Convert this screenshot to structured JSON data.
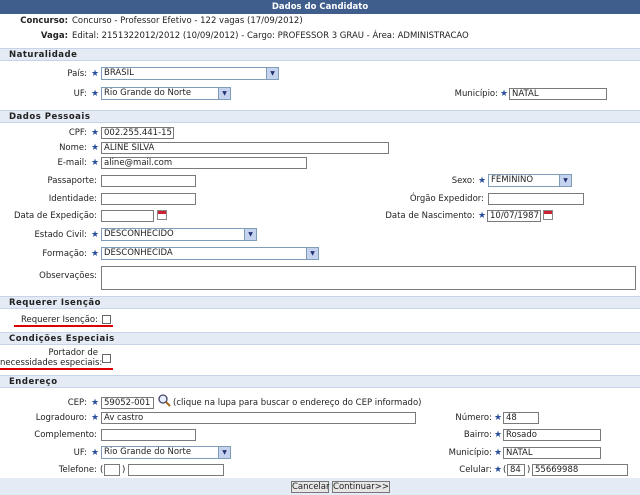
{
  "header": {
    "title": "Dados do Candidato"
  },
  "info": {
    "concurso_label": "Concurso:",
    "concurso_value": "Concurso - Professor Efetivo - 122 vagas (17/09/2012)",
    "vaga_label": "Vaga:",
    "vaga_value": "Edital: 2151322012/2012 (10/09/2012) - Cargo: PROFESSOR 3 GRAU - Área: ADMINISTRACAO"
  },
  "sections": {
    "naturalidade": "Naturalidade",
    "dados_pessoais": "Dados Pessoais",
    "isencao": "Requerer Isenção",
    "especiais": "Condições Especiais",
    "endereco": "Endereço"
  },
  "naturalidade": {
    "pais_label": "País:",
    "pais_value": "BRASIL",
    "uf_label": "UF:",
    "uf_value": "Rio Grande do Norte",
    "municipio_label": "Município:",
    "municipio_value": "NATAL"
  },
  "pessoais": {
    "cpf_label": "CPF:",
    "cpf_value": "002.255.441-15",
    "nome_label": "Nome:",
    "nome_value": "ALINE SILVA",
    "email_label": "E-mail:",
    "email_value": "aline@mail.com",
    "passaporte_label": "Passaporte:",
    "passaporte_value": "",
    "sexo_label": "Sexo:",
    "sexo_value": "FEMININO",
    "identidade_label": "Identidade:",
    "identidade_value": "",
    "orgao_label": "Órgão Expedidor:",
    "orgao_value": "",
    "expedicao_label": "Data de Expedição:",
    "expedicao_value": "",
    "nascimento_label": "Data de Nascimento:",
    "nascimento_value": "10/07/1987",
    "civil_label": "Estado Civil:",
    "civil_value": "DESCONHECIDO",
    "formacao_label": "Formação:",
    "formacao_value": "DESCONHECIDA",
    "obs_label": "Observações:"
  },
  "isencao": {
    "label": "Requerer Isenção:"
  },
  "especiais": {
    "label_line1": "Portador de",
    "label_line2": "necessidades especiais:"
  },
  "endereco": {
    "cep_label": "CEP:",
    "cep_value": "59052-001",
    "cep_hint": "(clique na lupa para buscar o endereço do CEP informado)",
    "logradouro_label": "Logradouro:",
    "logradouro_value": "Av castro",
    "numero_label": "Número:",
    "numero_value": "48",
    "complemento_label": "Complemento:",
    "complemento_value": "",
    "bairro_label": "Bairro:",
    "bairro_value": "Rosado",
    "uf_label": "UF:",
    "uf_value": "Rio Grande do Norte",
    "municipio_label": "Município:",
    "municipio_value": "NATAL",
    "telefone_label": "Telefone:",
    "telefone_ddd": "",
    "telefone_value": "",
    "celular_label": "Celular:",
    "celular_ddd": "84",
    "celular_value": "55669988"
  },
  "buttons": {
    "cancelar": "Cancelar",
    "continuar": "Continuar>>"
  },
  "colors": {
    "header": "#3f5e8c",
    "section_bg": "#e4ebf5",
    "required": "#2a4f9a",
    "highlight": "#dd0000"
  }
}
